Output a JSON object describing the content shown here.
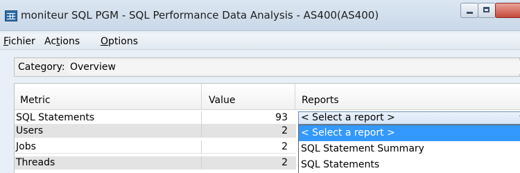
{
  "window": {
    "title": "moniteur SQL PGM - SQL Performance Data Analysis - AS400(AS400)",
    "icon": "table-app-icon"
  },
  "menu": {
    "items": [
      {
        "underline": "F",
        "rest": "ichier"
      },
      {
        "pre": "Ac",
        "underline": "t",
        "rest": "ions"
      },
      {
        "underline": "O",
        "rest": "ptions"
      }
    ]
  },
  "category": {
    "label": "Category:",
    "value": "Overview"
  },
  "table": {
    "headers": {
      "metric": "Metric",
      "value": "Value",
      "reports": "Reports"
    },
    "rows": [
      {
        "metric": "SQL Statements",
        "value": "93"
      },
      {
        "metric": "Users",
        "value": "2"
      },
      {
        "metric": "Jobs",
        "value": "2"
      },
      {
        "metric": "Threads",
        "value": "2"
      }
    ]
  },
  "reports": {
    "selected": "< Select a report >",
    "options": [
      "< Select a report >",
      "SQL Statement Summary",
      "SQL Statements"
    ]
  },
  "colors": {
    "selection": "#3399ff",
    "titlebar": "#c9d8e8"
  }
}
